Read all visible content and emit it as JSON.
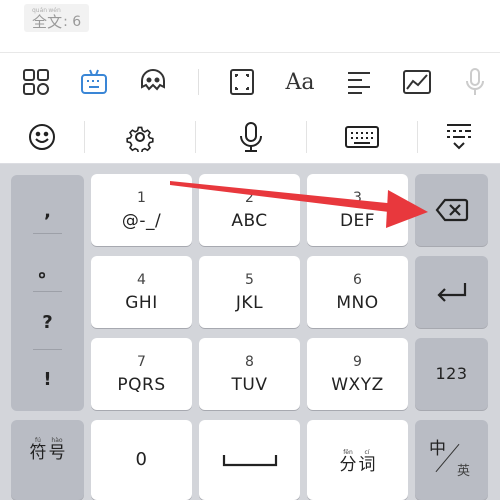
{
  "document": {
    "label_chars": [
      {
        "pinyin": "quán",
        "char": "全"
      },
      {
        "pinyin": "wén",
        "char": "文"
      }
    ],
    "count": ": 6"
  },
  "toolbar": {
    "icons": [
      "apps-grid-icon",
      "keyboard-robot-icon",
      "sticker-face-icon",
      "crop-frame-icon",
      "font-icon",
      "align-left-icon",
      "chart-image-icon",
      "voice-mic-icon"
    ],
    "font_label": "Aa"
  },
  "function_bar": {
    "icons": [
      "emoji-icon",
      "settings-gear-icon",
      "microphone-icon",
      "keyboard-icon",
      "collapse-keyboard-icon"
    ]
  },
  "keyboard": {
    "punctuation": [
      ",",
      "。",
      "?",
      "!"
    ],
    "keys": [
      {
        "num": "1",
        "letters": "@-_/"
      },
      {
        "num": "2",
        "letters": "ABC"
      },
      {
        "num": "3",
        "letters": "DEF"
      },
      {
        "num": "4",
        "letters": "GHI"
      },
      {
        "num": "5",
        "letters": "JKL"
      },
      {
        "num": "6",
        "letters": "MNO"
      },
      {
        "num": "7",
        "letters": "PQRS"
      },
      {
        "num": "8",
        "letters": "TUV"
      },
      {
        "num": "9",
        "letters": "WXYZ"
      }
    ],
    "symbols_key": [
      {
        "pinyin": "fú",
        "char": "符"
      },
      {
        "pinyin": "hào",
        "char": "号"
      }
    ],
    "zero_key": "0",
    "segment_key": [
      {
        "pinyin": "fēn",
        "char": "分"
      },
      {
        "pinyin": "cí",
        "char": "词"
      }
    ],
    "num_switch_key": "123",
    "lang_key": "中",
    "lang_key_sub": "英"
  },
  "colors": {
    "accent": "#3a86d6",
    "keyboard_bg": "#d3d5da",
    "dark_key": "#b9bcc4",
    "annotation_arrow": "#e8383d"
  }
}
